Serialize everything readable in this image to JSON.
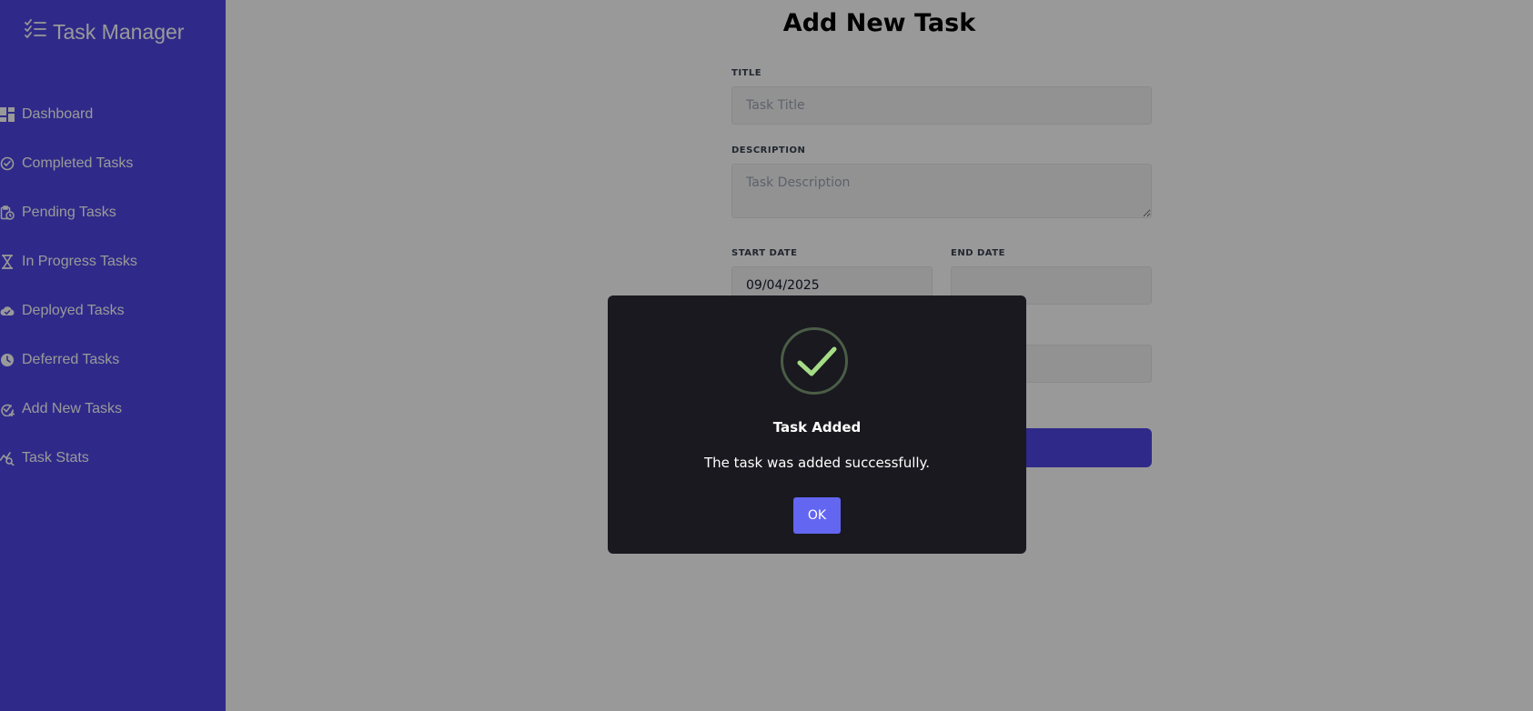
{
  "app": {
    "title": "Task Manager"
  },
  "sidebar": {
    "items": [
      {
        "label": "Dashboard",
        "icon": "dashboard-icon"
      },
      {
        "label": "Completed Tasks",
        "icon": "check-circle-icon"
      },
      {
        "label": "Pending Tasks",
        "icon": "clipboard-clock-icon"
      },
      {
        "label": "In Progress Tasks",
        "icon": "hourglass-icon"
      },
      {
        "label": "Deployed Tasks",
        "icon": "cloud-check-icon"
      },
      {
        "label": "Deferred Tasks",
        "icon": "clock-icon"
      },
      {
        "label": "Add New Tasks",
        "icon": "check-plus-icon"
      },
      {
        "label": "Task Stats",
        "icon": "chart-search-icon"
      }
    ]
  },
  "form": {
    "heading": "Add New Task",
    "title_label": "TITLE",
    "title_placeholder": "Task Title",
    "description_label": "DESCRIPTION",
    "description_placeholder": "Task Description",
    "start_date_label": "START DATE",
    "start_date_value": "09/04/2025",
    "end_date_label": "END DATE",
    "end_date_value": ""
  },
  "dialog": {
    "title": "Task Added",
    "message": "The task was added successfully.",
    "ok_label": "OK",
    "icon": "success-check-icon"
  },
  "colors": {
    "sidebar": "#4f46e5",
    "dialog_bg": "#19191f",
    "ok_button": "#6366f1",
    "success_check": "#a5dc86"
  }
}
